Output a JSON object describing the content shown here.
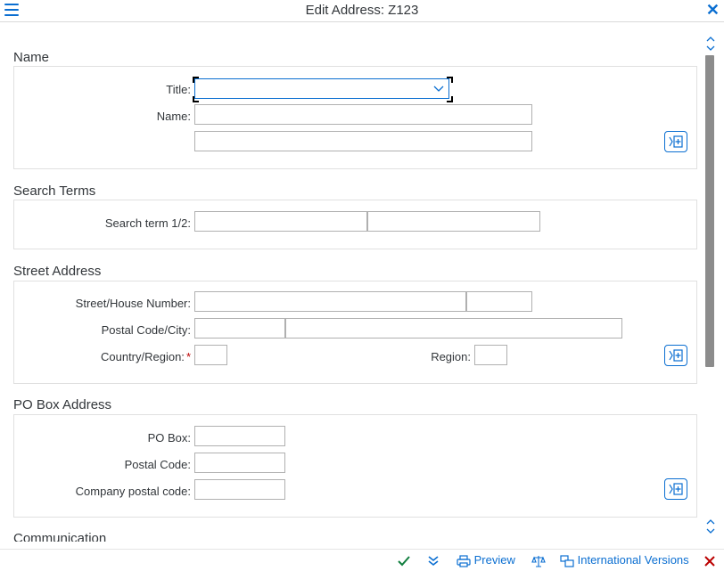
{
  "window": {
    "title": "Edit Address:  Z123",
    "menu_icon": "hamburger-menu-icon",
    "close_icon": "close-icon"
  },
  "groups": {
    "name": {
      "title": "Name",
      "title_label": "Title:",
      "title_value": "",
      "name_label": "Name:",
      "name_line1": "",
      "name_line2": ""
    },
    "search": {
      "title": "Search Terms",
      "label": "Search term 1/2:",
      "term1": "",
      "term2": ""
    },
    "street": {
      "title": "Street Address",
      "street_label": "Street/House Number:",
      "street": "",
      "house_number": "",
      "postal_label": "Postal Code/City:",
      "postal_code": "",
      "city": "",
      "country_label": "Country/Region:",
      "country_required": "*",
      "country": "",
      "region_label": "Region:",
      "region": ""
    },
    "pobox": {
      "title": "PO Box Address",
      "pobox_label": "PO Box:",
      "pobox": "",
      "postal_label": "Postal Code:",
      "postal_code": "",
      "company_label": "Company postal code:",
      "company_postal_code": ""
    },
    "next": {
      "title": "Communication"
    }
  },
  "footer": {
    "preview_label": "Preview",
    "international_label": "International Versions"
  },
  "colors": {
    "accent": "#0a6ed1",
    "confirm": "#107e3e",
    "cancel": "#bb0000",
    "required": "#bb0000"
  }
}
